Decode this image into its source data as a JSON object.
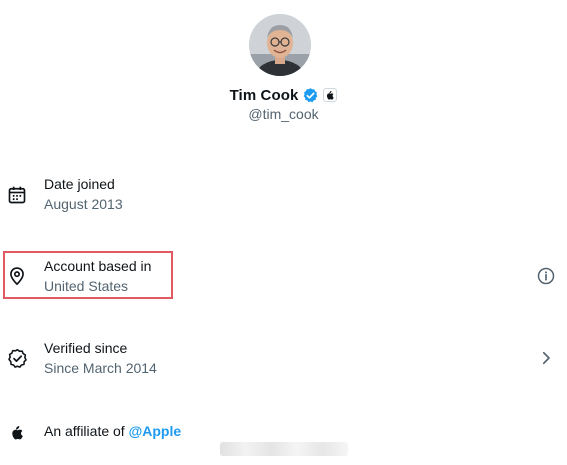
{
  "profile": {
    "name": "Tim Cook",
    "handle": "@tim_cook",
    "avatar_icon": "profile-photo",
    "verified_color": "#1d9bf0"
  },
  "rows": {
    "joined": {
      "title": "Date joined",
      "value": "August 2013",
      "icon": "calendar-icon"
    },
    "based": {
      "title": "Account based in",
      "value": "United States",
      "icon": "location-pin-icon",
      "action_icon": "info-icon"
    },
    "verified": {
      "title": "Verified since",
      "value": "Since March 2014",
      "icon": "verified-badge-outline-icon",
      "action_icon": "chevron-right-icon"
    },
    "affiliate": {
      "prefix": "An affiliate of ",
      "link": "@Apple",
      "icon": "apple-logo-icon",
      "link_color": "#1d9bf0"
    }
  },
  "colors": {
    "highlight": "#e25a61",
    "primary_text": "#0f1419",
    "secondary_text": "#536471"
  }
}
